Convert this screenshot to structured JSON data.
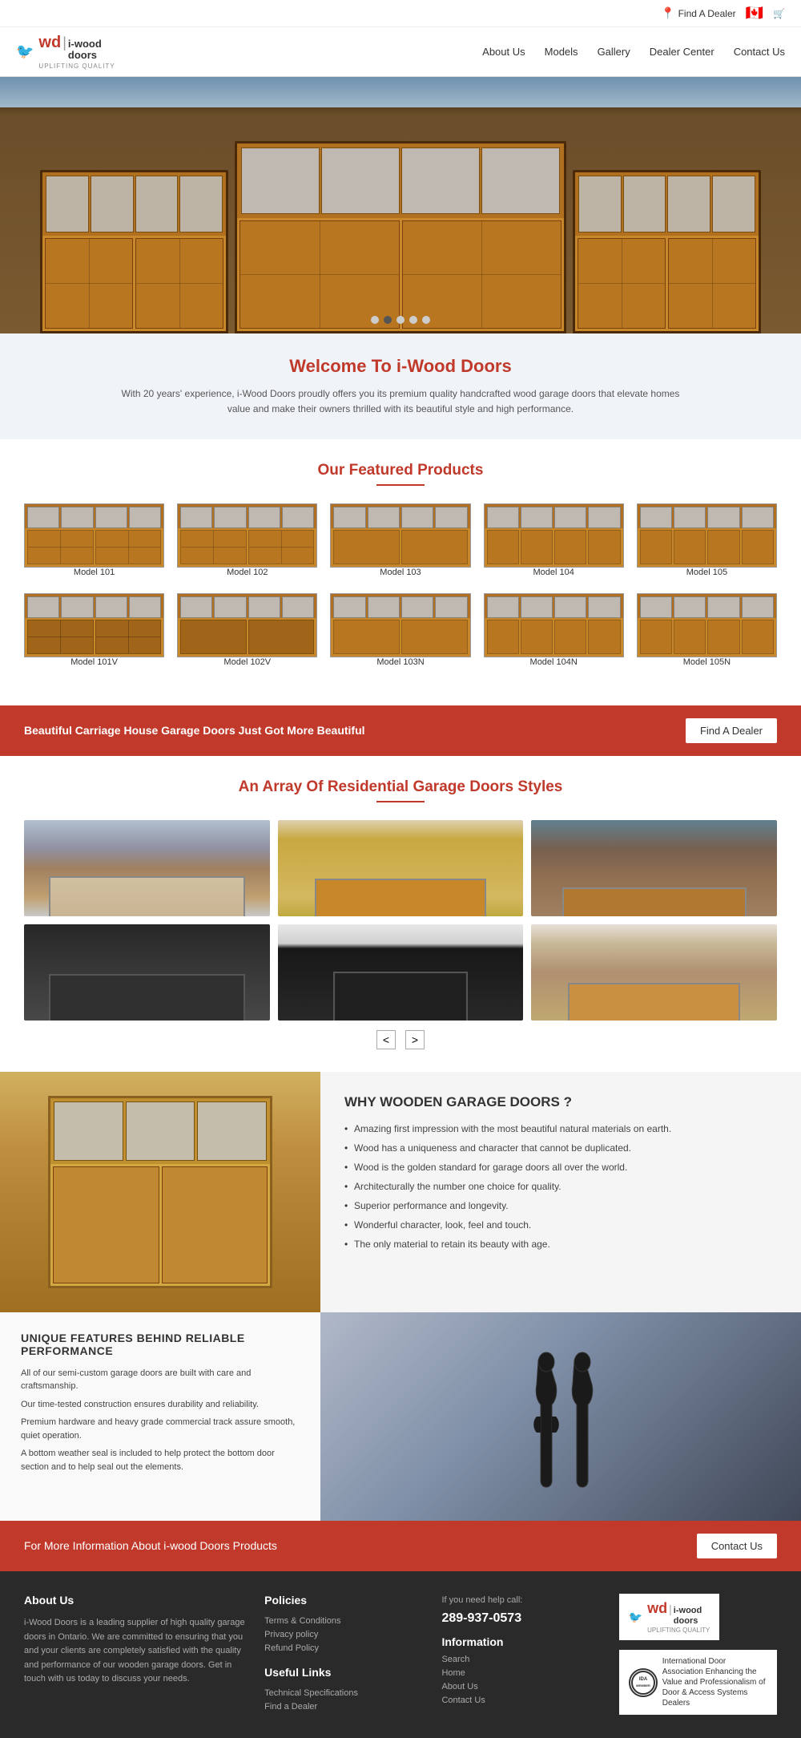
{
  "topbar": {
    "find_dealer": "Find A Dealer",
    "cart_icon": "🛒",
    "flag_icon": "🇨🇦"
  },
  "nav": {
    "logo_wd": "wd",
    "logo_name": "i-wood\ndoors",
    "logo_sub": "UPLIFTING QUALITY",
    "links": [
      {
        "label": "About Us",
        "id": "about-us"
      },
      {
        "label": "Models",
        "id": "models"
      },
      {
        "label": "Gallery",
        "id": "gallery"
      },
      {
        "label": "Dealer Center",
        "id": "dealer-center"
      },
      {
        "label": "Contact Us",
        "id": "contact-us"
      }
    ]
  },
  "hero": {
    "slider_dots": [
      1,
      2,
      3,
      4,
      5
    ],
    "active_dot": 1
  },
  "welcome": {
    "title": "Welcome To i-Wood Doors",
    "description": "With 20 years' experience, i-Wood Doors proudly offers you its premium quality handcrafted wood garage doors that elevate homes value and make their owners thrilled with its beautiful style and high performance."
  },
  "featured": {
    "title": "Our Featured Products",
    "products_row1": [
      {
        "label": "Model 101",
        "id": "model-101"
      },
      {
        "label": "Model 102",
        "id": "model-102"
      },
      {
        "label": "Model 103",
        "id": "model-103"
      },
      {
        "label": "Model 104",
        "id": "model-104"
      },
      {
        "label": "Model 105",
        "id": "model-105"
      }
    ],
    "products_row2": [
      {
        "label": "Model 101V",
        "id": "model-101v"
      },
      {
        "label": "Model 102V",
        "id": "model-102v"
      },
      {
        "label": "Model 103N",
        "id": "model-103n"
      },
      {
        "label": "Model 104N",
        "id": "model-104n"
      },
      {
        "label": "Model 105N",
        "id": "model-105n"
      }
    ]
  },
  "banner": {
    "text": "Beautiful Carriage House Garage Doors Just Got More Beautiful",
    "button": "Find A Dealer"
  },
  "residential": {
    "title": "An Array Of Residential Garage Doors Styles",
    "prev": "<",
    "next": ">"
  },
  "why": {
    "title": "WHY WOODEN GARAGE DOORS ?",
    "points": [
      "Amazing first impression with the most beautiful natural materials on earth.",
      "Wood has a uniqueness and character that cannot be duplicated.",
      "Wood is the golden standard for garage doors all over the world.",
      "Architecturally the number one choice for quality.",
      "Superior performance and longevity.",
      "Wonderful character, look, feel and touch.",
      "The only material to retain its beauty with age."
    ]
  },
  "unique": {
    "title": "UNIQUE FEATURES BEHIND RELIABLE PERFORMANCE",
    "points": [
      "All of our semi-custom garage doors are built with care and craftsmanship.",
      "Our time-tested construction ensures durability and reliability.",
      "Premium hardware and heavy grade commercial track assure smooth, quiet operation.",
      "A bottom weather seal is included to help protect the bottom door section and to help seal out the elements."
    ]
  },
  "info_banner": {
    "text": "For More Information About i-wood Doors Products",
    "button": "Contact Us"
  },
  "footer": {
    "about_title": "About Us",
    "about_text": "i-Wood Doors is a leading supplier of high quality garage doors in Ontario. We are committed to ensuring that you and your clients are completely satisfied with the quality and performance of our wooden garage doors. Get in touch with us today to discuss your needs.",
    "policies_title": "Policies",
    "policies_links": [
      "Terms & Conditions",
      "Privacy policy",
      "Refund Policy"
    ],
    "useful_title": "Useful Links",
    "useful_links": [
      "Technical Specifications",
      "Find a Dealer"
    ],
    "help_label": "If you need help call:",
    "phone": "289-937-0573",
    "info_title": "Information",
    "info_links": [
      "Search",
      "Home",
      "About Us",
      "Contact Us"
    ],
    "logo_wd": "wd",
    "logo_name": "i-wood\ndoors",
    "logo_sub": "UPLIFTING QUALITY",
    "ida_label": "IDA",
    "ida_text": "International Door Association\nEnhancing the Value and Professionalism\nof Door & Access Systems Dealers"
  }
}
